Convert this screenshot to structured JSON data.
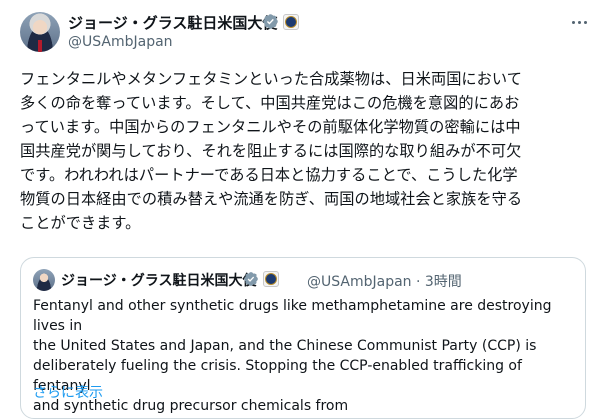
{
  "author": {
    "name": "ジョージ・グラス駐日米国大使",
    "handle": "@USAmbJapan"
  },
  "post": {
    "text": "フェンタニルやメタンフェタミンといった合成薬物は、日米両国において\n多くの命を奪っています。そして、中国共産党はこの危機を意図的にあお\nっています。中国からのフェンタニルやその前駆体化学物質の密輸には中\n国共産党が関与しており、それを阻止するには国際的な取り組みが不可欠\nです。われわれはパートナーである日本と協力することで、こうした化学\n物質の日本経由での積み替えや流通を防ぎ、両国の地域社会と家族を守る\nことができます。"
  },
  "quoted": {
    "name": "ジョージ・グラス駐日米国大使",
    "handle_time": "@USAmbJapan · 3時間",
    "text": "Fentanyl and other synthetic drugs like methamphetamine are destroying lives in\nthe United States and Japan, and the Chinese Communist Party (CCP) is\ndeliberately fueling the crisis. Stopping the CCP-enabled trafficking of fentanyl\nand synthetic drug precursor chemicals from",
    "show_more": "さらに表示"
  },
  "icons": {
    "verified": "verified-badge-icon",
    "affiliate": "us-embassy-seal-icon",
    "more": "more-options-icon"
  },
  "colors": {
    "verified_gray": "#829aab",
    "link_blue": "#1d9bf0",
    "secondary_text": "#536471",
    "border": "#cfd9de"
  }
}
